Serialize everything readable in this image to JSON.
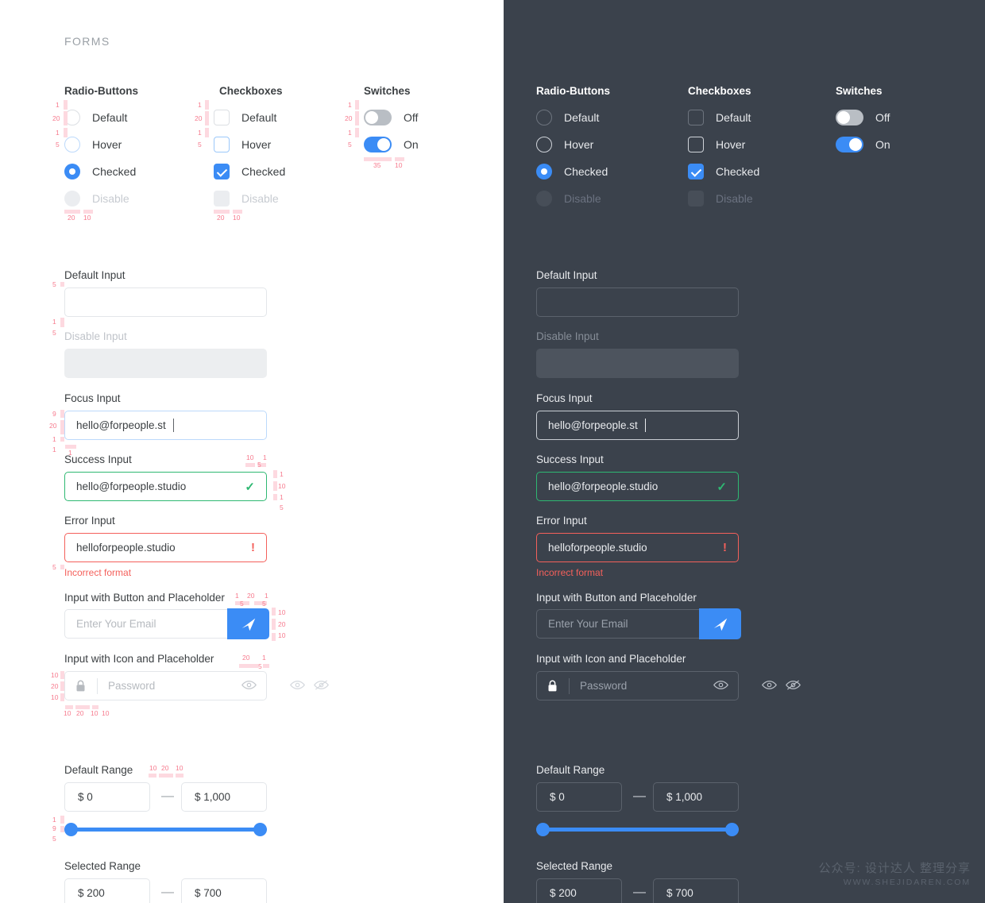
{
  "section": {
    "title": "FORMS"
  },
  "groups": {
    "radio": {
      "title": "Radio-Buttons",
      "items": [
        {
          "label": "Default",
          "state": "default"
        },
        {
          "label": "Hover",
          "state": "hover"
        },
        {
          "label": "Checked",
          "state": "checked"
        },
        {
          "label": "Disable",
          "state": "disabled"
        }
      ]
    },
    "checkbox": {
      "title": "Checkboxes",
      "items": [
        {
          "label": "Default",
          "state": "default"
        },
        {
          "label": "Hover",
          "state": "hover"
        },
        {
          "label": "Checked",
          "state": "checked"
        },
        {
          "label": "Disable",
          "state": "disabled"
        }
      ]
    },
    "switch": {
      "title": "Switches",
      "items": [
        {
          "label": "Off",
          "state": "off"
        },
        {
          "label": "On",
          "state": "on"
        }
      ]
    }
  },
  "inputs": {
    "default": {
      "label": "Default Input",
      "value": "",
      "placeholder": ""
    },
    "disable": {
      "label": "Disable Input",
      "value": "",
      "placeholder": ""
    },
    "focus": {
      "label": "Focus Input",
      "value": "hello@forpeople.st"
    },
    "success": {
      "label": "Success Input",
      "value": "hello@forpeople.studio",
      "icon": "check-icon"
    },
    "error": {
      "label": "Error Input",
      "value": "helloforpeople.studio",
      "icon": "exclamation-icon",
      "message": "Incorrect format"
    },
    "button_input": {
      "label": "Input with Button and Placeholder",
      "placeholder": "Enter Your Email",
      "button_icon": "send-icon"
    },
    "icon_input": {
      "label": "Input with Icon and Placeholder",
      "placeholder": "Password",
      "leading_icon": "lock-icon",
      "trailing_icon": "eye-icon",
      "extra_icons": [
        "eye-icon",
        "eye-slash-icon"
      ]
    }
  },
  "ranges": {
    "default": {
      "label": "Default Range",
      "min_value": "$ 0",
      "max_value": "$ 1,000",
      "separator": "—",
      "fill_start_pct": 0,
      "fill_end_pct": 100
    },
    "selected": {
      "label": "Selected Range",
      "min_value": "$ 200",
      "max_value": "$ 700",
      "separator": "—"
    }
  },
  "annotations": {
    "radio": {
      "top1": "1",
      "top2": "20",
      "mid1": "1",
      "mid2": "5",
      "bottom1": "20",
      "bottom2": "10"
    },
    "checkbox": {
      "top1": "1",
      "top2": "20",
      "mid1": "1",
      "mid2": "5",
      "bottom1": "20",
      "bottom2": "10"
    },
    "switch": {
      "top1": "1",
      "top2": "20",
      "mid1": "1",
      "mid2": "5",
      "bottom1": "35",
      "bottom2": "10"
    },
    "default_input": {
      "a": "5",
      "b": "1",
      "c": "5"
    },
    "focus_input": {
      "a": "9",
      "b": "20",
      "c": "1",
      "d": "1",
      "e": "1"
    },
    "success_input": {
      "top1": "10",
      "top2": "1",
      "top3": "5",
      "r1": "1",
      "r2": "10",
      "r3": "1",
      "r4": "5"
    },
    "error_input": {
      "a": "5"
    },
    "button_input": {
      "t1": "1",
      "t2": "20",
      "t3": "1",
      "t4": "5",
      "t5": "5",
      "r1": "10",
      "r2": "20",
      "r3": "10"
    },
    "icon_input": {
      "t1": "20",
      "t2": "1",
      "t3": "5",
      "l1": "10",
      "l2": "20",
      "l3": "10",
      "b1": "10",
      "b2": "20",
      "b3": "10",
      "b4": "10"
    },
    "range_default": {
      "t1": "10",
      "t2": "20",
      "t3": "10",
      "l1": "1",
      "l2": "9",
      "l3": "5"
    }
  },
  "watermark": {
    "cn": "公众号: 设计达人 整理分享",
    "url": "WWW.SHEJIDAREN.COM"
  },
  "colors": {
    "accent": "#3b8cf5",
    "success": "#2eb872",
    "error": "#f4605b",
    "dark_bg": "#3b424c",
    "light_bg": "#ffffff",
    "annotation": "#f77b8e"
  }
}
